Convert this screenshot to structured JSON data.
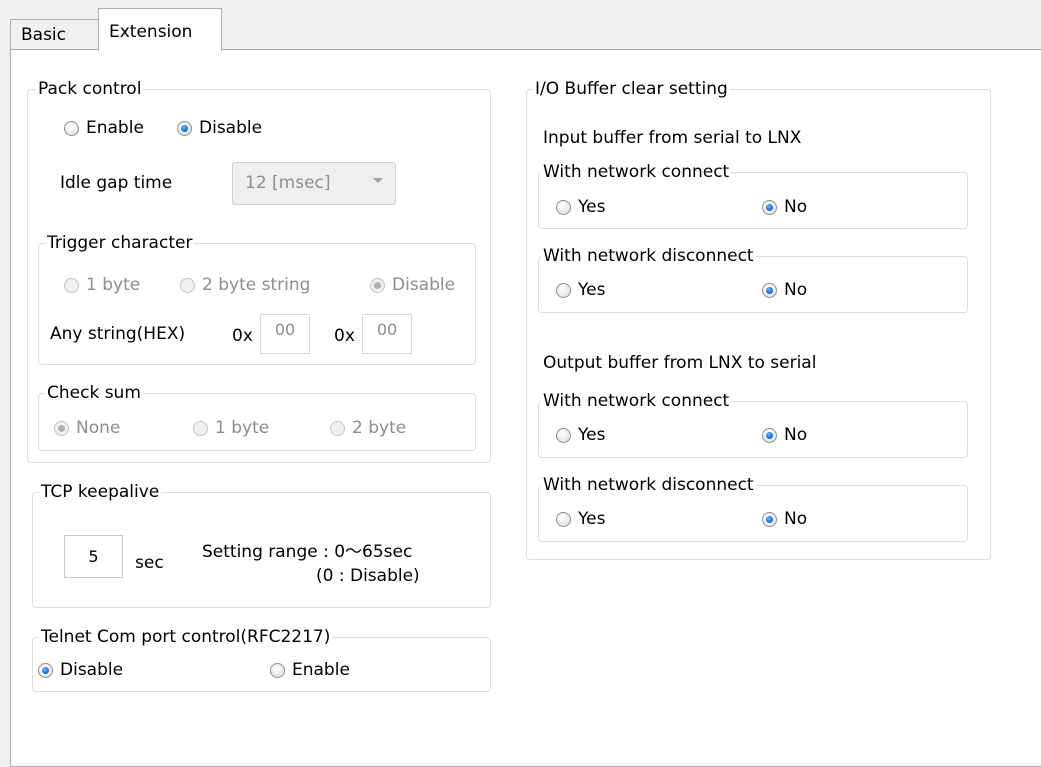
{
  "tabs": [
    {
      "label": "Basic"
    },
    {
      "label": "Extension"
    }
  ],
  "pack_control": {
    "title": "Pack control",
    "enable_label": "Enable",
    "disable_label": "Disable",
    "selected": "Disable",
    "idle_gap_label": "Idle gap time",
    "idle_gap_value": "12 [msec]"
  },
  "trigger_character": {
    "title": "Trigger character",
    "option_1byte": "1 byte",
    "option_2byte": "2 byte string",
    "option_disable": "Disable",
    "selected": "Disable",
    "any_string_label": "Any string(HEX)",
    "prefix1": "0x",
    "value1": "00",
    "prefix2": "0x",
    "value2": "00"
  },
  "check_sum": {
    "title": "Check sum",
    "option_none": "None",
    "option_1byte": "1 byte",
    "option_2byte": "2 byte",
    "selected": "None"
  },
  "tcp_keepalive": {
    "title": "TCP keepalive",
    "value": "5",
    "unit": "sec",
    "range_label": "Setting range : 0〜65sec",
    "range_note": "(0 : Disable)"
  },
  "telnet": {
    "title": "Telnet Com port control(RFC2217)",
    "disable_label": "Disable",
    "enable_label": "Enable",
    "selected": "Disable"
  },
  "io_buffer": {
    "title": "I/O Buffer clear setting",
    "input_heading": "Input buffer from serial to LNX",
    "output_heading": "Output buffer from LNX to serial",
    "input_connect": {
      "title": "With network connect",
      "yes": "Yes",
      "no": "No",
      "selected": "No"
    },
    "input_disconnect": {
      "title": "With network disconnect",
      "yes": "Yes",
      "no": "No",
      "selected": "No"
    },
    "output_connect": {
      "title": "With network connect",
      "yes": "Yes",
      "no": "No",
      "selected": "No"
    },
    "output_disconnect": {
      "title": "With network disconnect",
      "yes": "Yes",
      "no": "No",
      "selected": "No"
    }
  }
}
